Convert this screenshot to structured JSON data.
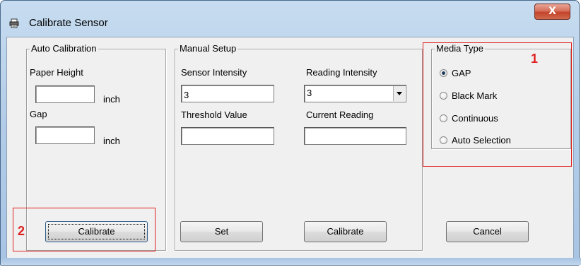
{
  "window": {
    "title": "Calibrate Sensor",
    "close_label": "X"
  },
  "auto_calibration": {
    "legend": "Auto Calibration",
    "paper_height_label": "Paper Height",
    "paper_height_value": "",
    "paper_height_unit": "inch",
    "gap_label": "Gap",
    "gap_value": "",
    "gap_unit": "inch",
    "calibrate_label": "Calibrate"
  },
  "manual_setup": {
    "legend": "Manual Setup",
    "sensor_intensity_label": "Sensor Intensity",
    "sensor_intensity_value": "3",
    "reading_intensity_label": "Reading Intensity",
    "reading_intensity_value": "3",
    "threshold_label": "Threshold Value",
    "threshold_value": "",
    "current_reading_label": "Current Reading",
    "current_reading_value": "",
    "set_label": "Set",
    "calibrate_label": "Calibrate"
  },
  "media_type": {
    "legend": "Media Type",
    "options": [
      {
        "label": "GAP",
        "checked": true
      },
      {
        "label": "Black Mark",
        "checked": false
      },
      {
        "label": "Continuous",
        "checked": false
      },
      {
        "label": "Auto Selection",
        "checked": false
      }
    ]
  },
  "cancel_label": "Cancel",
  "annotations": [
    {
      "number": "1"
    },
    {
      "number": "2"
    }
  ],
  "colors": {
    "annotation": "#e02020",
    "title_gradient": "#b3cde8",
    "dialog_bg": "#f0f0f0"
  }
}
